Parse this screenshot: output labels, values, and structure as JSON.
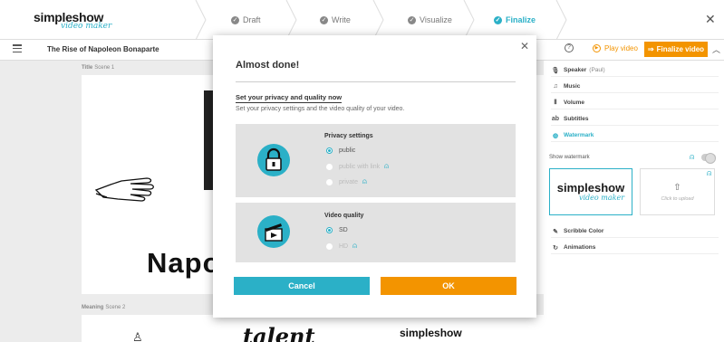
{
  "app": {
    "logo_main": "simpleshow",
    "logo_sub": "video maker"
  },
  "steps": [
    {
      "label": "Draft",
      "state": "done"
    },
    {
      "label": "Write",
      "state": "done"
    },
    {
      "label": "Visualize",
      "state": "done"
    },
    {
      "label": "Finalize",
      "state": "active"
    }
  ],
  "toolbar": {
    "project_title": "The Rise of Napoleon Bonaparte",
    "play_label": "Play video",
    "finalize_label": "Finalize video"
  },
  "scenes": [
    {
      "name": "Title",
      "label": "Scene 1",
      "text": "Napo"
    },
    {
      "name": "Meaning",
      "label": "Scene 2",
      "text": "talent",
      "logo": "simpleshow"
    }
  ],
  "right_panel": {
    "items": [
      {
        "label": "Speaker",
        "extra": "(Paul)",
        "icon": "microphone-icon"
      },
      {
        "label": "Music",
        "icon": "music-note-icon"
      },
      {
        "label": "Volume",
        "icon": "volume-bars-icon"
      },
      {
        "label": "Subtitles",
        "icon": "subtitles-icon"
      },
      {
        "label": "Watermark",
        "icon": "watermark-icon",
        "active": true
      },
      {
        "label": "Scribble Color",
        "icon": "pen-icon"
      },
      {
        "label": "Animations",
        "icon": "animation-icon"
      }
    ],
    "show_watermark_label": "Show watermark",
    "watermark_logo_main": "simpleshow",
    "watermark_logo_sub": "video maker",
    "upload_label": "Click to upload"
  },
  "modal": {
    "title": "Almost done!",
    "subtitle": "Set your privacy and quality now",
    "description": "Set your privacy settings and the video quality of your video.",
    "privacy": {
      "heading": "Privacy settings",
      "options": [
        {
          "label": "public",
          "selected": true,
          "premium": false
        },
        {
          "label": "public with link",
          "selected": false,
          "premium": true
        },
        {
          "label": "private",
          "selected": false,
          "premium": true
        }
      ]
    },
    "quality": {
      "heading": "Video quality",
      "options": [
        {
          "label": "SD",
          "selected": true,
          "premium": false
        },
        {
          "label": "HD",
          "selected": false,
          "premium": true
        }
      ]
    },
    "cancel_label": "Cancel",
    "ok_label": "OK"
  },
  "colors": {
    "accent": "#2bb0c7",
    "orange": "#f39400"
  }
}
